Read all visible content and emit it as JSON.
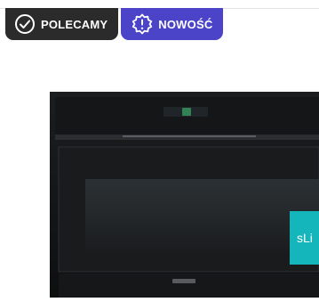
{
  "badges": [
    {
      "label": "POLECAMY",
      "icon": "check-circle-icon",
      "color": "#2b2b2b"
    },
    {
      "label": "NOWOŚĆ",
      "icon": "exclamation-burst-icon",
      "color": "#4b44c9"
    }
  ],
  "product": {
    "image": "built-in-oven-black"
  },
  "side_tab": {
    "label": "sLi",
    "color": "#15b6bb"
  }
}
